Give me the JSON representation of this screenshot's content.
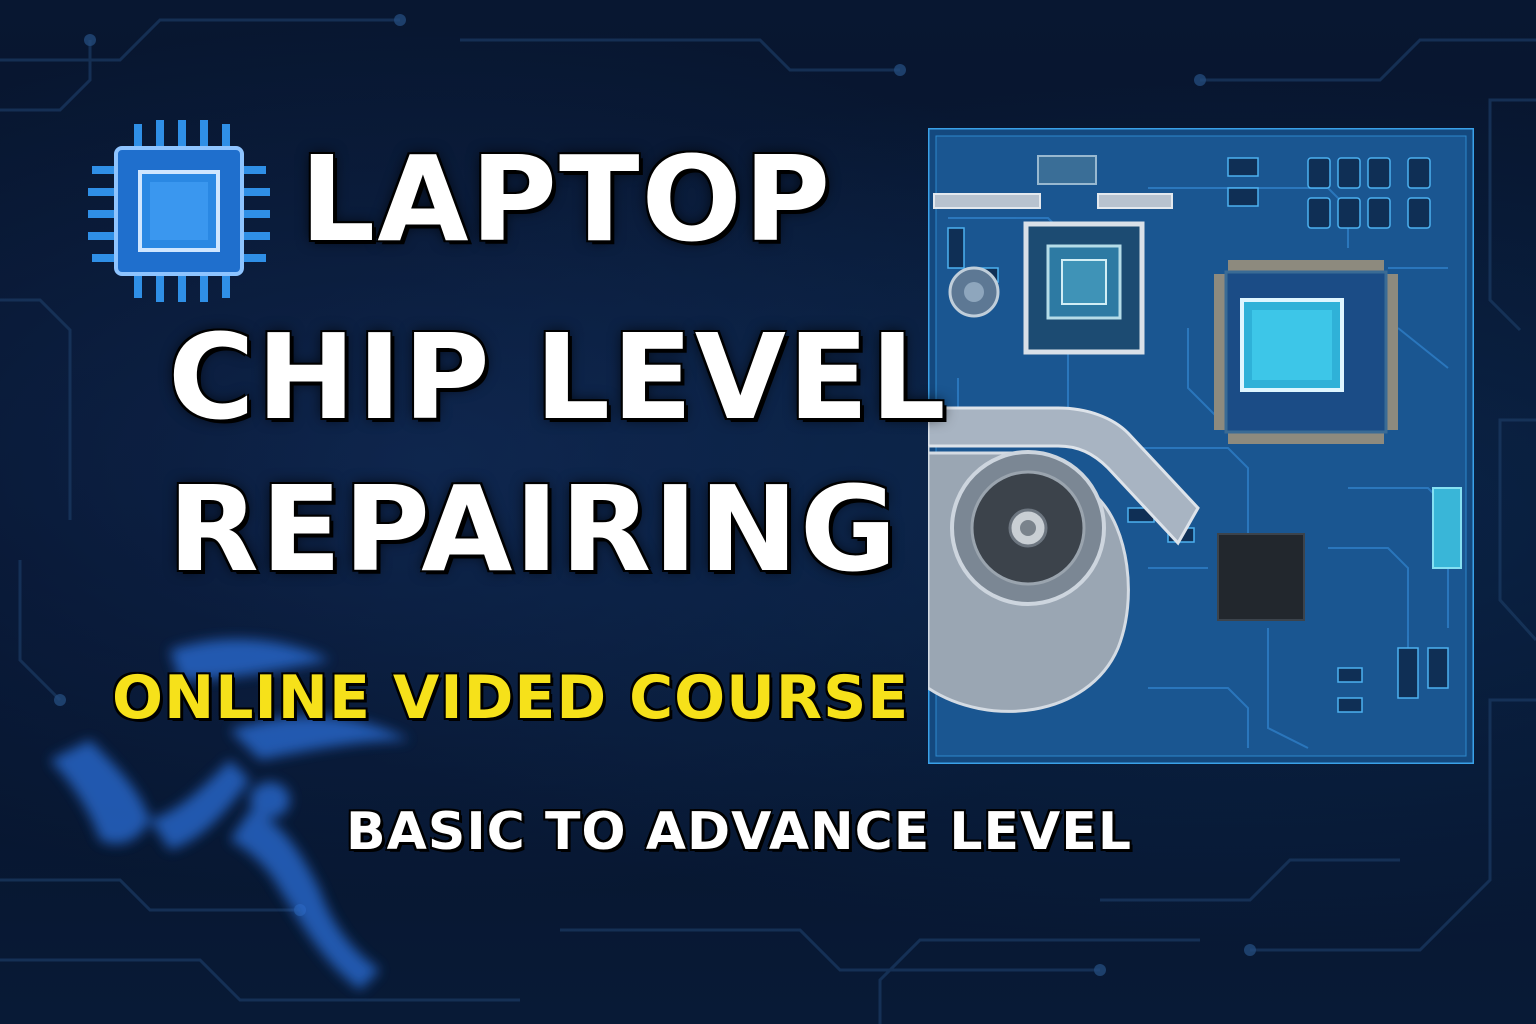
{
  "headline": {
    "line_1": "LAPTOP",
    "line_2": "CHIP LEVEL",
    "line_3": "REPAIRING"
  },
  "subtitle": "ONLINE VIDED COURSE",
  "tagline": "BASIC TO ADVANCE LEVEL",
  "icons": {
    "chip": "chip-icon",
    "board": "motherboard-illustration"
  },
  "colors": {
    "background": "#07142b",
    "headline": "#ffffff",
    "subtitle": "#f6e11a",
    "accent_blue": "#2f8fe6",
    "board_blue": "#1a4f8c"
  }
}
